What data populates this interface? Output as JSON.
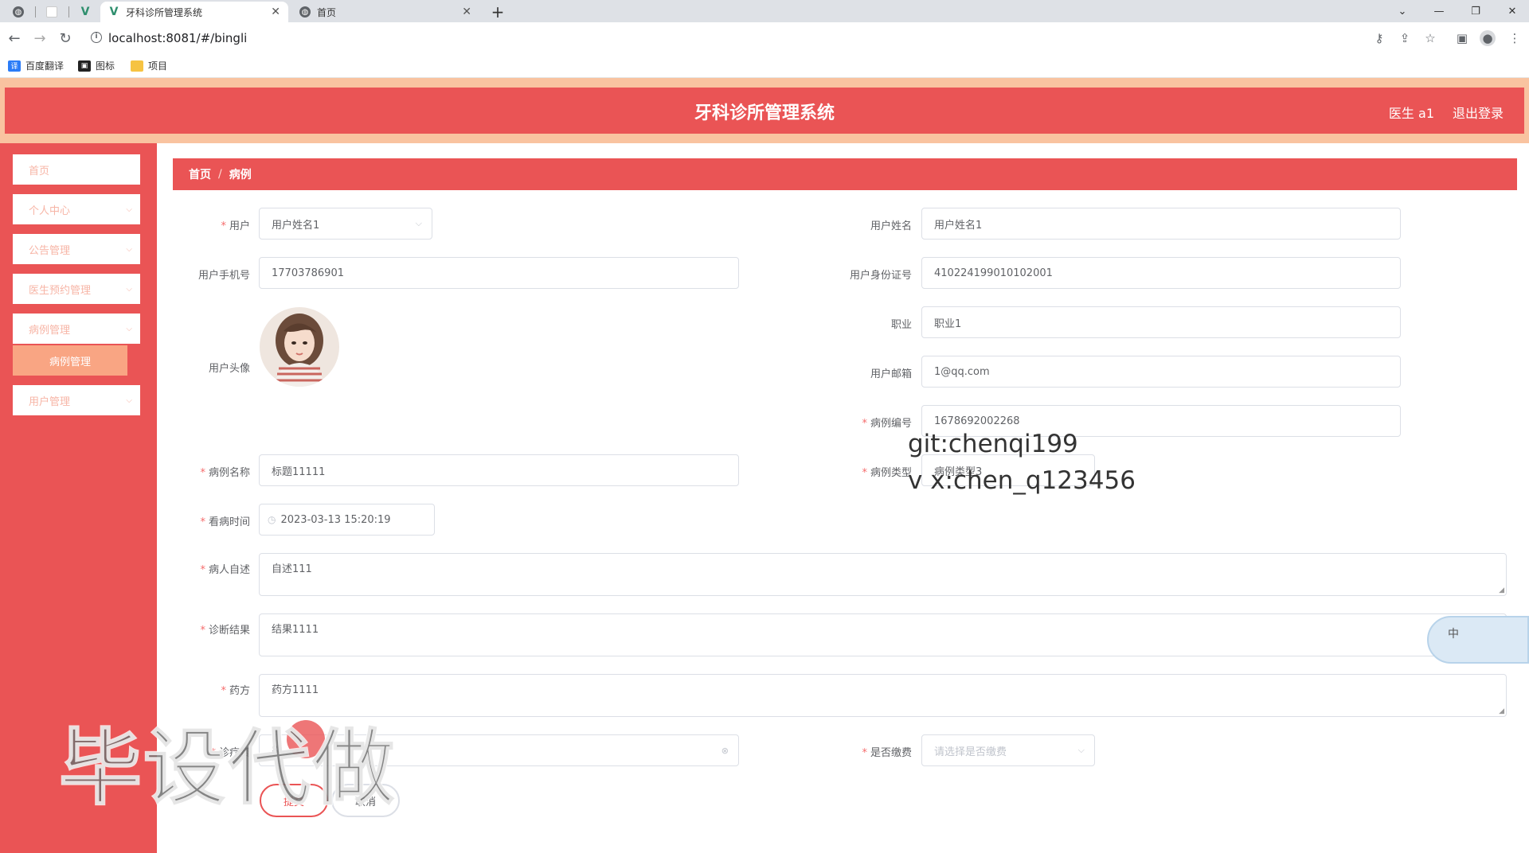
{
  "browser": {
    "tabs": [
      {
        "title": ""
      },
      {
        "title": ""
      },
      {
        "title": ""
      },
      {
        "title": "牙科诊所管理系统",
        "active": true
      },
      {
        "title": "首页"
      }
    ],
    "new_tab": "+",
    "url": "localhost:8081/#/bingli",
    "bookmarks": [
      {
        "label": "百度翻译",
        "icon": "translate-icon",
        "color": "#2b7cf7"
      },
      {
        "label": "图标",
        "icon": "picture-icon",
        "color": "#222222"
      },
      {
        "label": "项目",
        "icon": "folder-icon",
        "color": "#f6c342"
      }
    ]
  },
  "header": {
    "title": "牙科诊所管理系统",
    "user": "医生 a1",
    "logout": "退出登录"
  },
  "sidebar": {
    "items": [
      {
        "label": "首页"
      },
      {
        "label": "个人中心"
      },
      {
        "label": "公告管理"
      },
      {
        "label": "医生预约管理"
      },
      {
        "label": "病例管理"
      },
      {
        "label": "用户管理"
      }
    ],
    "subitem": "病例管理"
  },
  "breadcrumb": {
    "home": "首页",
    "sep": "/",
    "current": "病例"
  },
  "form": {
    "user_label": "用户",
    "user_value": "用户姓名1",
    "username_label": "用户姓名",
    "username_value": "用户姓名1",
    "phone_label": "用户手机号",
    "phone_value": "17703786901",
    "idcard_label": "用户身份证号",
    "idcard_value": "410224199010102001",
    "avatar_label": "用户头像",
    "job_label": "职业",
    "job_value": "职业1",
    "email_label": "用户邮箱",
    "email_value": "1@qq.com",
    "case_no_label": "病例编号",
    "case_no_value": "1678692002268",
    "case_name_label": "病例名称",
    "case_name_value": "标题11111",
    "case_type_label": "病例类型",
    "case_type_value": "病例类型3",
    "visit_time_label": "看病时间",
    "visit_time_value": "2023-03-13 15:20:19",
    "self_report_label": "病人自述",
    "self_report_value": "自述111",
    "diagnosis_label": "诊断结果",
    "diagnosis_value": "结果1111",
    "prescription_label": "药方",
    "prescription_value": "药方1111",
    "fee_label": "诊疗费",
    "fee_value": "8",
    "paid_label": "是否缴费",
    "paid_placeholder": "请选择是否缴费",
    "submit": "提交",
    "cancel": "取消"
  },
  "overlays": {
    "git": "git:chenqi199",
    "vx": "v x:chen_q123456",
    "big": "毕设代做",
    "ime": "中"
  },
  "colors": {
    "primary": "#ea5455",
    "accent": "#f9a583",
    "top_band": "#f9c3a0"
  }
}
